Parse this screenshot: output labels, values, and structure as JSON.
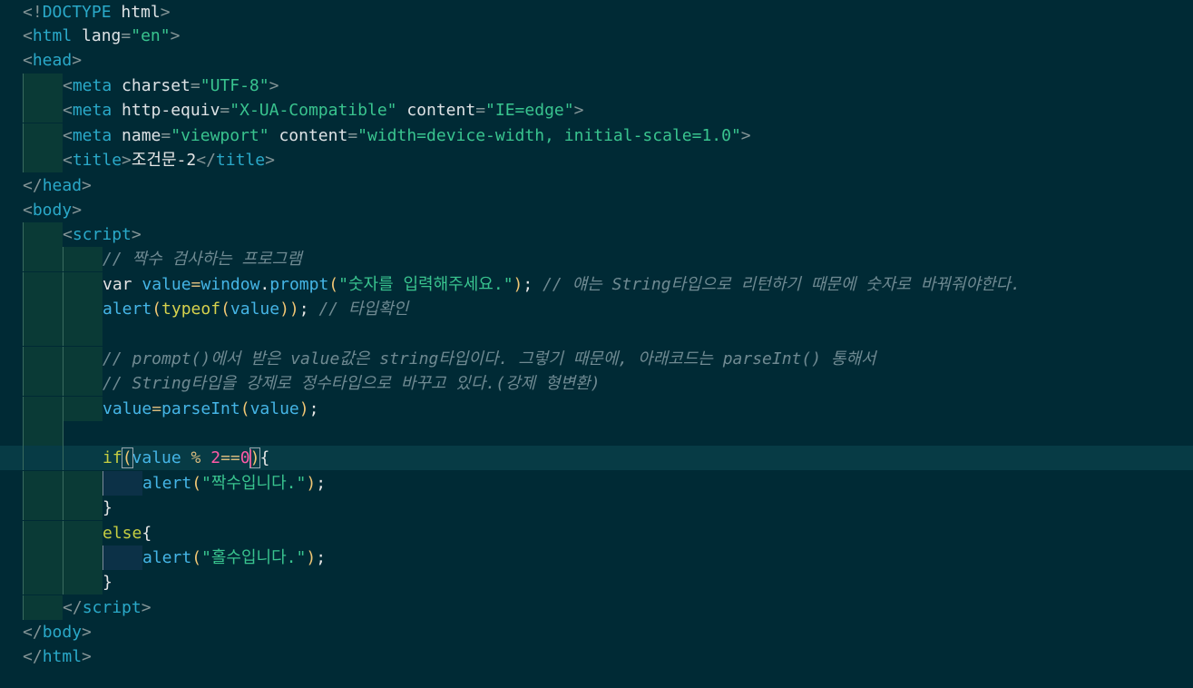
{
  "editor": {
    "theme_bg": "#002a35",
    "lines": {
      "l1": {
        "a": "<!",
        "b": "DOCTYPE",
        "c": " html",
        "d": ">"
      },
      "l2": {
        "a": "<",
        "b": "html",
        "c": " lang",
        "d": "=",
        "e": "\"en\"",
        "f": ">"
      },
      "l3": {
        "a": "<",
        "b": "head",
        "c": ">"
      },
      "l4": {
        "a": "<",
        "b": "meta",
        "c": " charset",
        "d": "=",
        "e": "\"UTF-8\"",
        "f": ">"
      },
      "l5": {
        "a": "<",
        "b": "meta",
        "c": " http-equiv",
        "d": "=",
        "e": "\"X-UA-Compatible\"",
        "f": " content",
        "g": "=",
        "h": "\"IE=edge\"",
        "i": ">"
      },
      "l6": {
        "a": "<",
        "b": "meta",
        "c": " name",
        "d": "=",
        "e": "\"viewport\"",
        "f": " content",
        "g": "=",
        "h": "\"width=device-width, initial-scale=1.0\"",
        "i": ">"
      },
      "l7": {
        "a": "<",
        "b": "title",
        "c": ">",
        "d": "조건문-2",
        "e": "</",
        "f": "title",
        "g": ">"
      },
      "l8": {
        "a": "</",
        "b": "head",
        "c": ">"
      },
      "l9": {
        "a": "<",
        "b": "body",
        "c": ">"
      },
      "l10": {
        "a": "<",
        "b": "script",
        "c": ">"
      },
      "l11": {
        "a": "// 짝수 검사하는 프로그램"
      },
      "l12": {
        "a": "var",
        "b": " value",
        "c": "=",
        "d": "window",
        "e": ".",
        "f": "prompt",
        "g": "(",
        "h": "\"숫자를 입력해주세요.\"",
        "i": ")",
        "j": "; ",
        "k": "// 얘는 String타입으로 리턴하기 때문에 숫자로 바꿔줘야한다."
      },
      "l13": {
        "a": "alert",
        "b": "(",
        "c": "typeof",
        "d": "(",
        "e": "value",
        "f": "))",
        "g": "; ",
        "h": "// 타입확인"
      },
      "l14": {},
      "l15": {
        "a": "// prompt()에서 받은 value값은 string타입이다. 그렇기 때문에, 아래코드는 parseInt() 통해서"
      },
      "l16": {
        "a": "// String타입을 강제로 정수타입으로 바꾸고 있다.(강제 형변환)"
      },
      "l17": {
        "a": "value",
        "b": "=",
        "c": "parseInt",
        "d": "(",
        "e": "value",
        "f": ")",
        "g": ";"
      },
      "l18": {},
      "l19": {
        "a": "if",
        "b": "(",
        "c": "value",
        "d": " % ",
        "e": "2",
        "f": "==",
        "g": "0",
        "h": ")",
        "i": "{"
      },
      "l20": {
        "a": "alert",
        "b": "(",
        "c": "\"짝수입니다.\"",
        "d": ")",
        "e": ";"
      },
      "l21": {
        "a": "}"
      },
      "l22": {
        "a": "else",
        "b": "{"
      },
      "l23": {
        "a": "alert",
        "b": "(",
        "c": "\"홀수입니다.\"",
        "d": ")",
        "e": ";"
      },
      "l24": {
        "a": "}"
      },
      "l25": {
        "a": "</",
        "b": "script",
        "c": ">"
      },
      "l26": {
        "a": "</",
        "b": "body",
        "c": ">"
      },
      "l27": {
        "a": "</",
        "b": "html",
        "c": ">"
      }
    }
  }
}
